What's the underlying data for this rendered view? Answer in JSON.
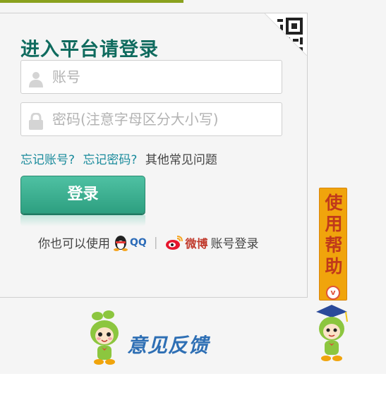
{
  "login": {
    "title": "进入平台请登录",
    "username_placeholder": "账号",
    "password_placeholder": "密码(注意字母区分大小写)",
    "forgot_account": "忘记账号?",
    "forgot_password": "忘记密码?",
    "faq": "其他常见问题",
    "login_button": "登录",
    "alt_prefix": "你也可以使用",
    "qq_label": "QQ",
    "weibo_label": "微博",
    "alt_suffix": "账号登录"
  },
  "help": {
    "label": "使用帮助",
    "chev": "v"
  },
  "feedback": {
    "label": "意见反馈"
  },
  "colors": {
    "accent": "#0f6b5e",
    "button": "#3fb394",
    "link": "#1a8b9c",
    "help_tab": "#f0a40c"
  }
}
